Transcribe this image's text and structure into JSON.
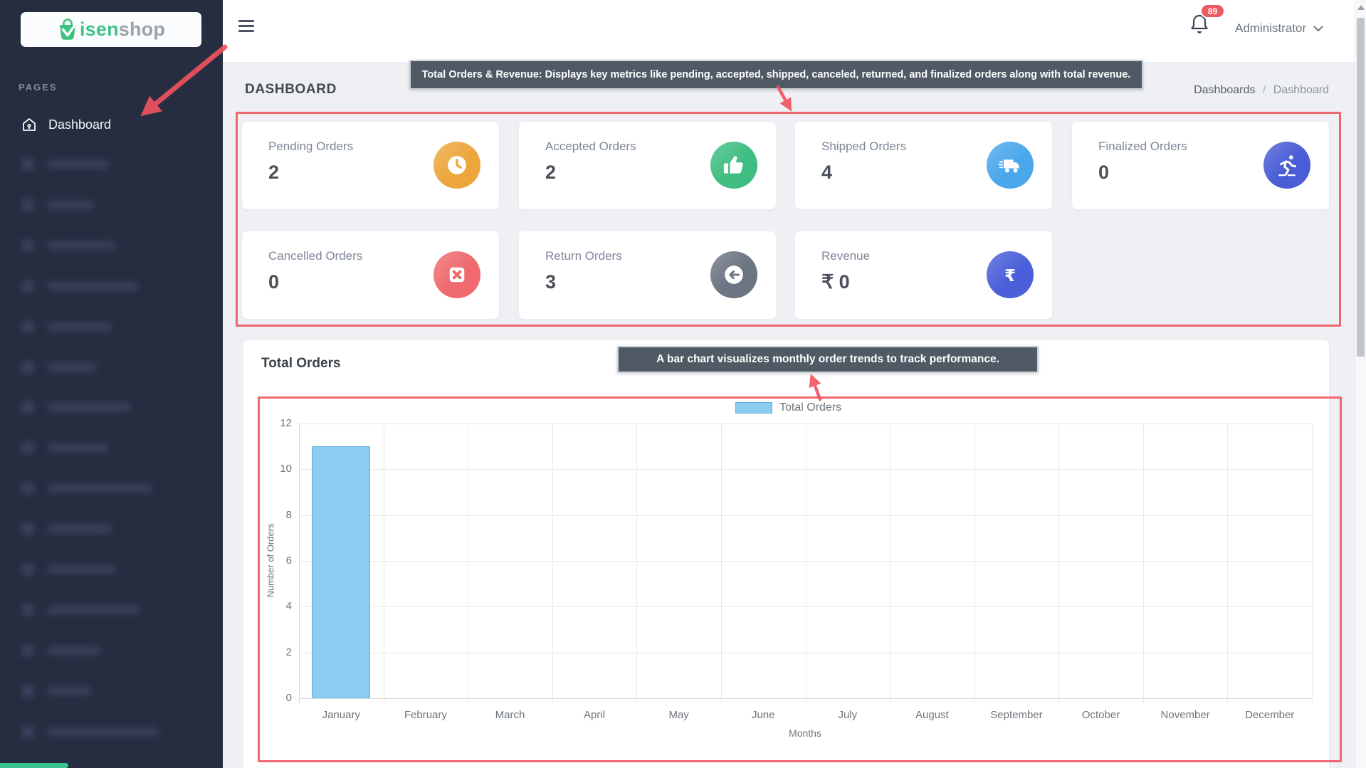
{
  "sidebar": {
    "brand": {
      "primary": "isen",
      "secondary": "shop"
    },
    "section_label": "PAGES",
    "dashboard_label": "Dashboard",
    "redacted_item_widths": [
      88,
      66,
      96,
      128,
      92,
      70,
      118,
      86,
      148,
      92,
      96,
      130,
      76,
      62,
      158
    ]
  },
  "topbar": {
    "notification_count": "89",
    "user_label": "Administrator"
  },
  "page": {
    "title": "DASHBOARD",
    "breadcrumb_parent": "Dashboards",
    "breadcrumb_separator": "/",
    "breadcrumb_current": "Dashboard"
  },
  "annotations": {
    "tooltip_cards": "Total Orders & Revenue: Displays key metrics like pending, accepted, shipped, canceled, returned, and finalized orders along with total revenue.",
    "tooltip_chart": "A bar chart visualizes monthly order trends to track performance.",
    "highlight_color": "#f04d57"
  },
  "cards": [
    {
      "label": "Pending Orders",
      "value": "2",
      "icon": "clock-icon",
      "color": "#eca63c"
    },
    {
      "label": "Accepted Orders",
      "value": "2",
      "icon": "thumbs-up-icon",
      "color": "#40bd80"
    },
    {
      "label": "Shipped Orders",
      "value": "4",
      "icon": "truck-icon",
      "color": "#4aa7ec"
    },
    {
      "label": "Finalized Orders",
      "value": "0",
      "icon": "skater-icon",
      "color": "#4a5cd6"
    },
    {
      "label": "Cancelled Orders",
      "value": "0",
      "icon": "cancel-icon",
      "color": "#ee6a6e"
    },
    {
      "label": "Return Orders",
      "value": "3",
      "icon": "return-icon",
      "color": "#6d7482"
    },
    {
      "label": "Revenue",
      "value": "₹ 0",
      "icon": "rupee-icon",
      "color": "#4a5fd9"
    }
  ],
  "chart_section": {
    "title": "Total Orders"
  },
  "chart_data": {
    "type": "bar",
    "legend": "Total Orders",
    "categories": [
      "January",
      "February",
      "March",
      "April",
      "May",
      "June",
      "July",
      "August",
      "September",
      "October",
      "November",
      "December"
    ],
    "values": [
      11,
      0,
      0,
      0,
      0,
      0,
      0,
      0,
      0,
      0,
      0,
      0
    ],
    "xlabel": "Months",
    "ylabel": "Number of Orders",
    "ylim": [
      0,
      12
    ],
    "ytick_step": 2,
    "bar_color": "#8bcdf0",
    "bar_border": "#64b0e0",
    "grid": true,
    "legend_position": "top"
  }
}
